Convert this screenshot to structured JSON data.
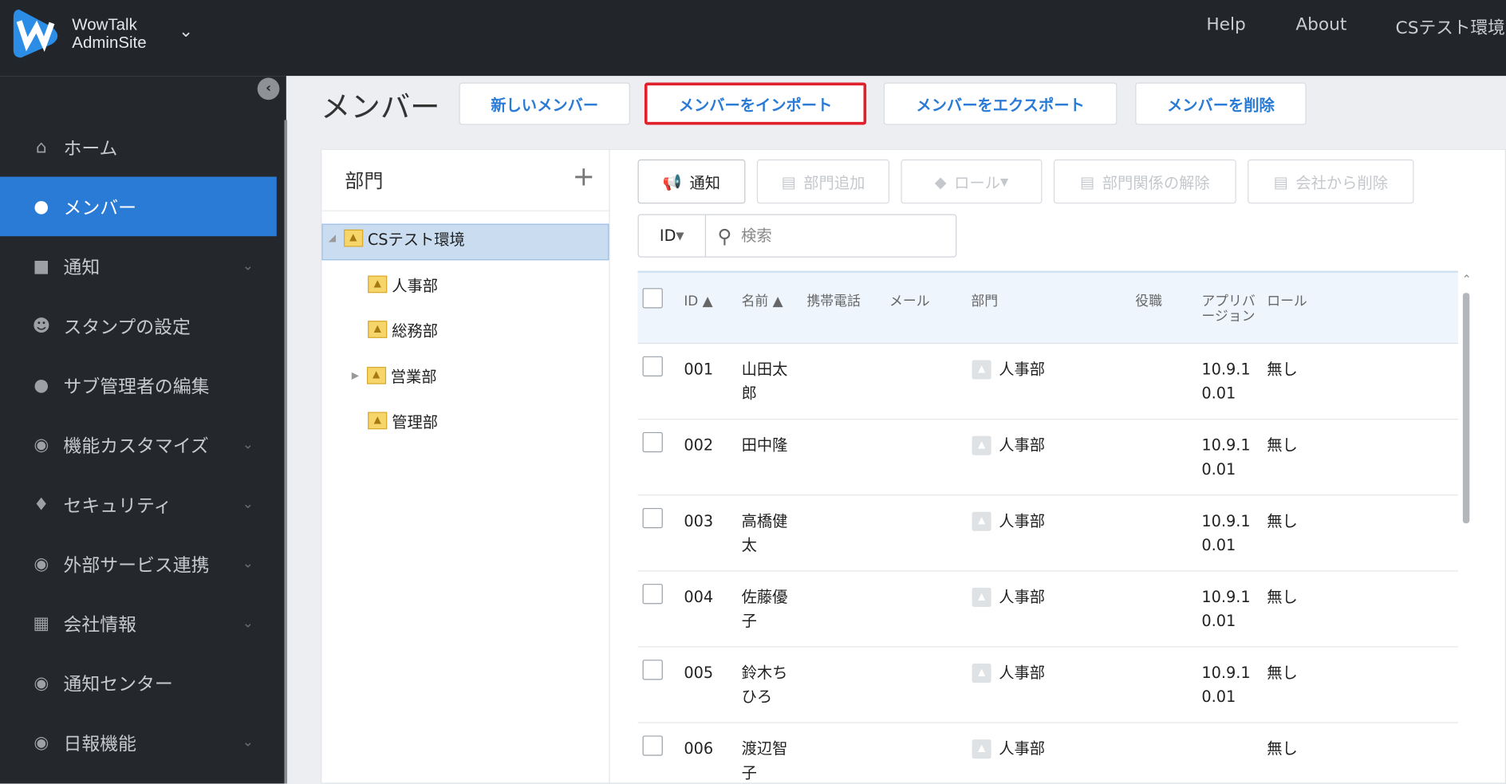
{
  "app": {
    "brand_line1": "WowTalk",
    "brand_line2": "AdminSite"
  },
  "topnav": {
    "help": "Help",
    "about": "About",
    "org": "CSテスト環境"
  },
  "sidebar": {
    "items": [
      {
        "label": "ホーム",
        "icon": "home-icon"
      },
      {
        "label": "メンバー",
        "icon": "user-icon",
        "active": true
      },
      {
        "label": "通知",
        "icon": "megaphone-icon",
        "expand": true
      },
      {
        "label": "スタンプの設定",
        "icon": "smiley-icon"
      },
      {
        "label": "サブ管理者の編集",
        "icon": "admin-user-icon"
      },
      {
        "label": "機能カスタマイズ",
        "icon": "toggle-icon",
        "expand": true
      },
      {
        "label": "セキュリティ",
        "icon": "shield-icon",
        "expand": true
      },
      {
        "label": "外部サービス連携",
        "icon": "link-icon",
        "expand": true
      },
      {
        "label": "会社情報",
        "icon": "building-icon",
        "expand": true
      },
      {
        "label": "通知センター",
        "icon": "notification-icon"
      },
      {
        "label": "日報機能",
        "icon": "report-icon",
        "expand": true
      }
    ]
  },
  "page": {
    "title": "メンバー",
    "buttons": {
      "new": "新しいメンバー",
      "import": "メンバーをインポート",
      "export": "メンバーをエクスポート",
      "delete": "メンバーを削除"
    }
  },
  "dept": {
    "title": "部門",
    "root": "CSテスト環境",
    "children": [
      "人事部",
      "総務部",
      "営業部",
      "管理部"
    ]
  },
  "toolbar": {
    "notify": "通知",
    "add_dept": "部門追加",
    "role": "ロール",
    "remove_dept": "部門関係の解除",
    "remove_company": "会社から削除"
  },
  "search": {
    "field": "ID",
    "placeholder": "検索"
  },
  "table": {
    "headers": {
      "id": "ID",
      "name": "名前",
      "mobile": "携帯電話",
      "mail": "メール",
      "dept": "部門",
      "position": "役職",
      "app_version_1": "アプリバ",
      "app_version_2": "ージョン",
      "role": "ロール"
    },
    "rows": [
      {
        "id": "001",
        "name1": "山田太",
        "name2": "郎",
        "dept": "人事部",
        "ver1": "10.9.1",
        "ver2": "0.01",
        "role": "無し"
      },
      {
        "id": "002",
        "name1": "田中隆",
        "name2": "",
        "dept": "人事部",
        "ver1": "10.9.1",
        "ver2": "0.01",
        "role": "無し"
      },
      {
        "id": "003",
        "name1": "高橋健",
        "name2": "太",
        "dept": "人事部",
        "ver1": "10.9.1",
        "ver2": "0.01",
        "role": "無し"
      },
      {
        "id": "004",
        "name1": "佐藤優",
        "name2": "子",
        "dept": "人事部",
        "ver1": "10.9.1",
        "ver2": "0.01",
        "role": "無し"
      },
      {
        "id": "005",
        "name1": "鈴木ち",
        "name2": "ひろ",
        "dept": "人事部",
        "ver1": "10.9.1",
        "ver2": "0.01",
        "role": "無し"
      },
      {
        "id": "006",
        "name1": "渡辺智",
        "name2": "子",
        "dept": "人事部",
        "ver1": "",
        "ver2": "",
        "role": "無し"
      }
    ]
  },
  "colors": {
    "accent": "#2a7bd5",
    "topbar": "#222529",
    "sidebar": "#24272b",
    "highlight": "#e0202a"
  }
}
